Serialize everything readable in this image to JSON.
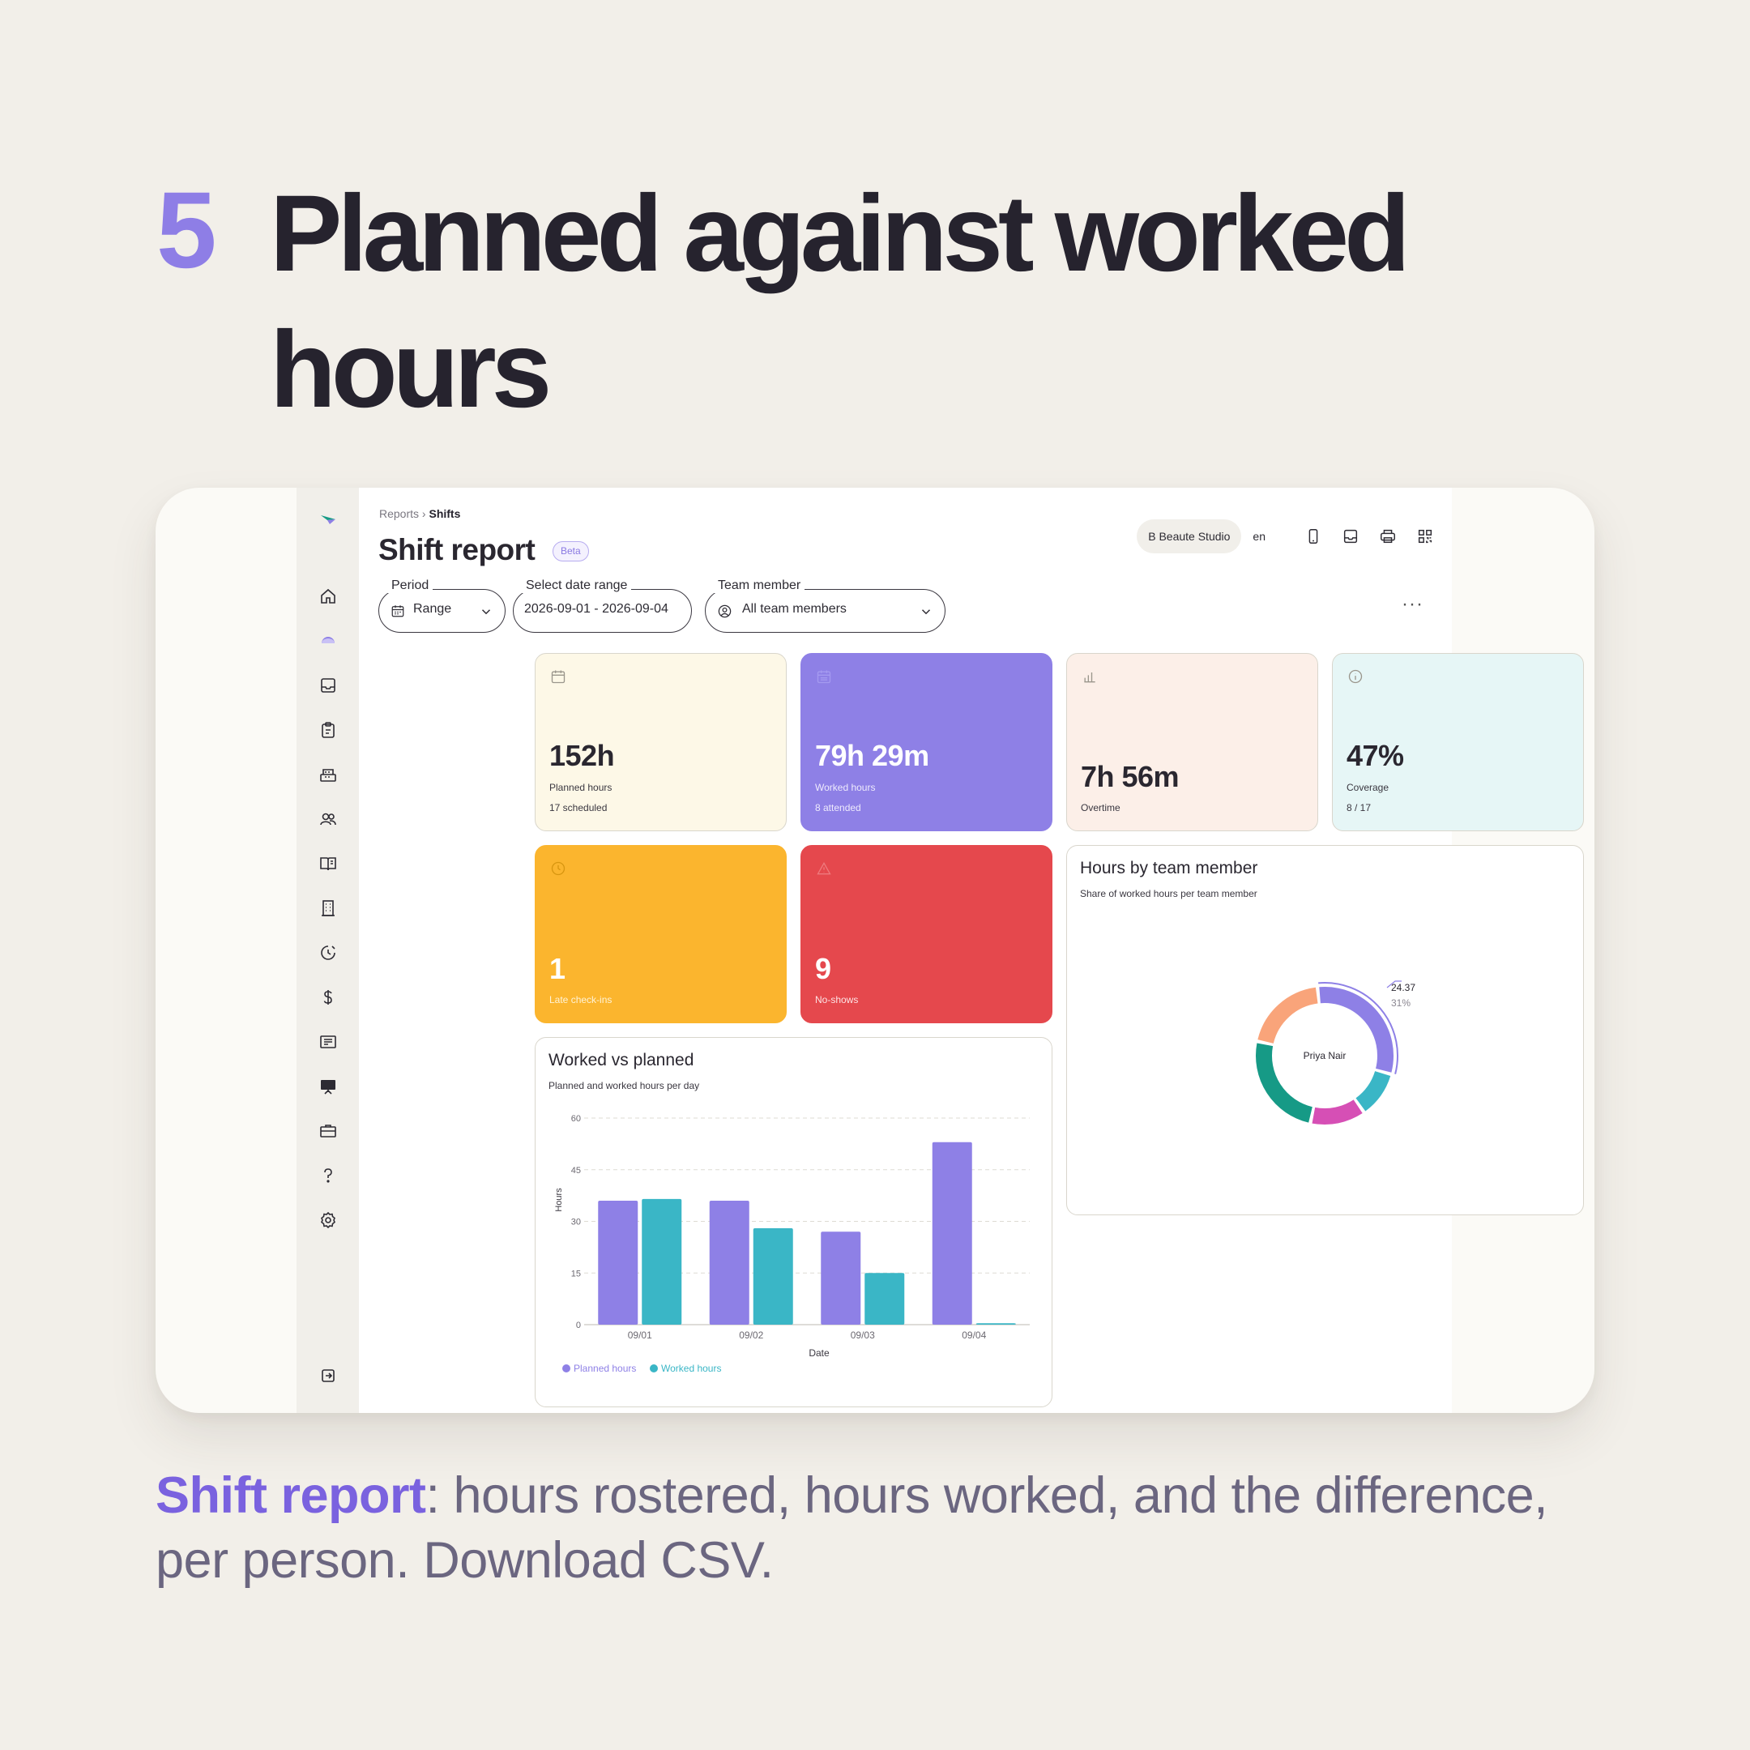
{
  "slide": {
    "number": "5",
    "title": "Planned against worked hours",
    "caption_highlight": "Shift report",
    "caption_rest": ": hours rostered, hours worked, and the difference, per person. Download CSV."
  },
  "breadcrumb": {
    "parent": "Reports",
    "current": "Shifts"
  },
  "page": {
    "title": "Shift report",
    "badge": "Beta"
  },
  "topbar": {
    "workspace": "B Beaute Studio",
    "language": "en"
  },
  "filters": {
    "period": {
      "label": "Period",
      "value": "Range"
    },
    "date_range": {
      "label": "Select date range",
      "value": "2026-09-01 - 2026-09-04"
    },
    "team_member": {
      "label": "Team member",
      "value": "All team members"
    },
    "more": "···"
  },
  "kpis": {
    "planned": {
      "value": "152h",
      "label": "Planned hours",
      "sub": "17 scheduled",
      "color": "#fdf8e7"
    },
    "worked": {
      "value": "79h 29m",
      "label": "Worked hours",
      "sub": "8 attended",
      "color": "#8e80e6"
    },
    "overtime": {
      "value": "7h 56m",
      "label": "Overtime",
      "color": "#fcefe8"
    },
    "coverage": {
      "value": "47%",
      "label": "Coverage",
      "sub": "8 / 17",
      "color": "#e6f6f6"
    },
    "late": {
      "value": "1",
      "label": "Late check-ins",
      "color": "#fbb52e"
    },
    "noshow": {
      "value": "9",
      "label": "No-shows",
      "color": "#e5484d"
    }
  },
  "donut": {
    "title": "Hours by team member",
    "subtitle": "Share of worked hours per team member",
    "center_label": "Priya Nair",
    "highlight_value": "24.37",
    "highlight_pct": "31%",
    "segments": [
      {
        "share": 31,
        "color": "#8e80e6"
      },
      {
        "share": 11,
        "color": "#3ab6c6"
      },
      {
        "share": 13,
        "color": "#d64fb5"
      },
      {
        "share": 25,
        "color": "#169a86"
      },
      {
        "share": 20,
        "color": "#f9a47a"
      }
    ]
  },
  "chart_data": {
    "type": "bar",
    "title": "Worked vs planned",
    "subtitle": "Planned and worked hours per day",
    "xlabel": "Date",
    "ylabel": "Hours",
    "categories": [
      "09/01",
      "09/02",
      "09/03",
      "09/04"
    ],
    "series": [
      {
        "name": "Planned hours",
        "values": [
          36,
          36,
          27,
          53
        ],
        "color": "#8e80e6"
      },
      {
        "name": "Worked hours",
        "values": [
          36.5,
          28,
          15,
          0.4
        ],
        "color": "#3ab6c6"
      }
    ],
    "yticks": [
      0,
      15,
      30,
      45,
      60
    ],
    "ylim": [
      0,
      60
    ],
    "grid": true,
    "legend": "bottom-left"
  }
}
